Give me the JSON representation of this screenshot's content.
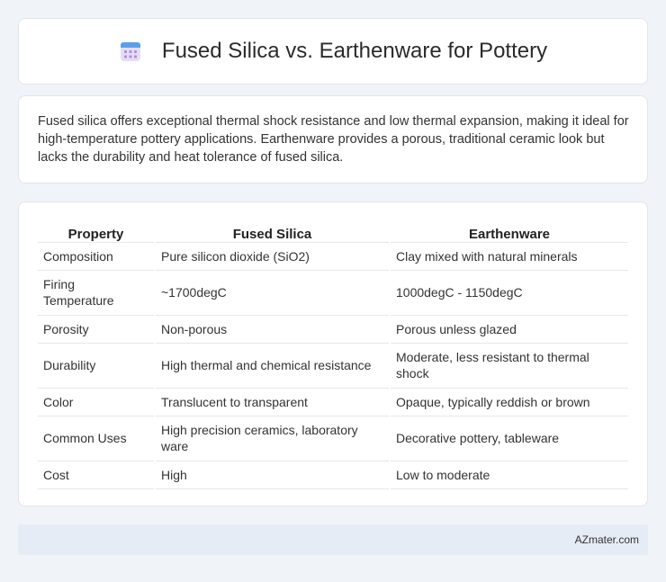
{
  "header": {
    "title": "Fused Silica vs. Earthenware for Pottery",
    "icon": "calendar-icon"
  },
  "summary": "Fused silica offers exceptional thermal shock resistance and low thermal expansion, making it ideal for high-temperature pottery applications. Earthenware provides a porous, traditional ceramic look but lacks the durability and heat tolerance of fused silica.",
  "table": {
    "headers": [
      "Property",
      "Fused Silica",
      "Earthenware"
    ],
    "rows": [
      [
        "Composition",
        "Pure silicon dioxide (SiO2)",
        "Clay mixed with natural minerals"
      ],
      [
        "Firing Temperature",
        "~1700degC",
        "1000degC - 1150degC"
      ],
      [
        "Porosity",
        "Non-porous",
        "Porous unless glazed"
      ],
      [
        "Durability",
        "High thermal and chemical resistance",
        "Moderate, less resistant to thermal shock"
      ],
      [
        "Color",
        "Translucent to transparent",
        "Opaque, typically reddish or brown"
      ],
      [
        "Common Uses",
        "High precision ceramics, laboratory ware",
        "Decorative pottery, tableware"
      ],
      [
        "Cost",
        "High",
        "Low to moderate"
      ]
    ]
  },
  "footer": {
    "brand": "AZmater.com"
  }
}
